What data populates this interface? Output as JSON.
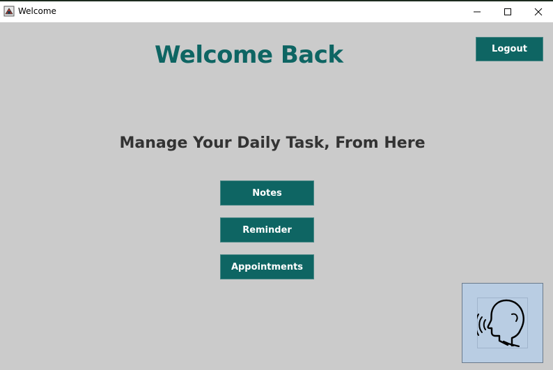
{
  "window": {
    "title": "Welcome"
  },
  "header": {
    "title": "Welcome Back",
    "logout_label": "Logout"
  },
  "main": {
    "subtitle": "Manage Your Daily Task, From Here",
    "buttons": [
      {
        "label": "Notes"
      },
      {
        "label": "Reminder"
      },
      {
        "label": "Appointments"
      }
    ]
  },
  "voice": {
    "icon": "speaking-head-icon"
  },
  "colors": {
    "accent": "#0e6563",
    "background": "#cbcbcb",
    "voice_button_bg": "#b9cde3"
  }
}
